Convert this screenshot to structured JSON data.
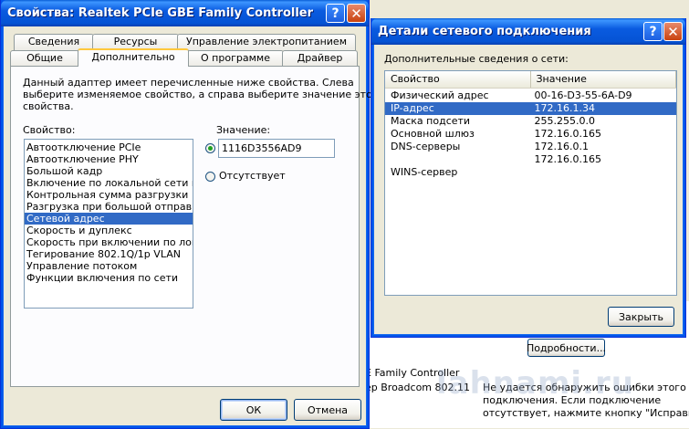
{
  "background": {
    "lines": [
      "E Family Controller",
      "ер Broadcom 802.11"
    ],
    "details_button": "Подробности...",
    "status_text": [
      "Не удается обнаружить ошибки этого",
      "подключения. Если подключение",
      "отсутствует, нажмите кнопку \"Исправить\"."
    ],
    "watermark": "lahnami.ru"
  },
  "adapter_window": {
    "title": "Свойства: Realtek PCIe GBE Family Controller",
    "tabs_row1": [
      "Сведения",
      "Ресурсы",
      "Управление электропитанием"
    ],
    "tabs_row2": [
      "Общие",
      "Дополнительно",
      "О программе",
      "Драйвер"
    ],
    "active_tab": "Дополнительно",
    "description": [
      "Данный адаптер имеет перечисленные ниже свойства. Слева",
      "выберите изменяемое свойство, а справа выберите значение этого",
      "свойства."
    ],
    "property_label": "Свойство:",
    "value_label": "Значение:",
    "properties": [
      "Автоотключение PCIe",
      "Автоотключение PHY",
      "Большой кадр",
      "Включение по локальной сети посл",
      "Контрольная сумма разгрузки",
      "Разгрузка при большой отправке",
      "Сетевой адрес",
      "Скорость и дуплекс",
      "Скорость при включении по локаль",
      "Тегирование 802.1Q/1p VLAN",
      "Управление потоком",
      "Функции включения по сети"
    ],
    "selected_property_index": 6,
    "value_input": "1116D3556AD9",
    "absent_label": "Отсутствует",
    "ok_label": "ОК",
    "cancel_label": "Отмена"
  },
  "details_window": {
    "title": "Детали сетевого подключения",
    "subtitle": "Дополнительные сведения о сети:",
    "columns": [
      "Свойство",
      "Значение"
    ],
    "rows": [
      {
        "property": "Физический адрес",
        "value": "00-16-D3-55-6A-D9"
      },
      {
        "property": "IP-адрес",
        "value": "172.16.1.34"
      },
      {
        "property": "Маска подсети",
        "value": "255.255.0.0"
      },
      {
        "property": "Основной шлюз",
        "value": "172.16.0.165"
      },
      {
        "property": "DNS-серверы",
        "value": "172.16.0.1"
      },
      {
        "property": "",
        "value": "172.16.0.165"
      },
      {
        "property": "WINS-сервер",
        "value": ""
      }
    ],
    "selected_row_index": 1,
    "close_label": "Закрыть"
  },
  "colors": {
    "selection": "#316ac5",
    "titlebar": "#0553d4"
  }
}
